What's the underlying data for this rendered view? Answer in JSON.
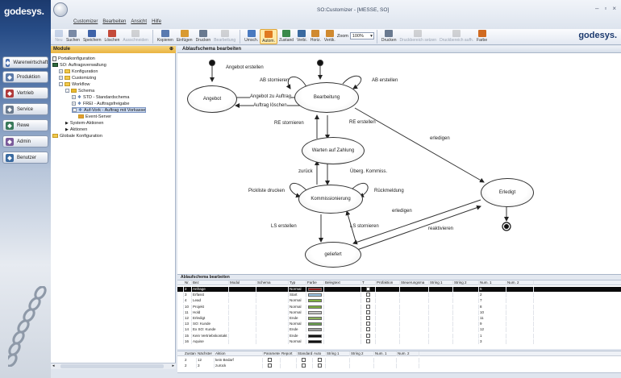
{
  "brand": "godesys.",
  "window": {
    "title": "SO:Customizer - [MESSE, SO]"
  },
  "menu": [
    "Customizer",
    "Bearbeiten",
    "Ansicht",
    "Hilfe"
  ],
  "nav": [
    {
      "label": "Warenwirtschaft",
      "color": "#4a6fb0"
    },
    {
      "label": "Produktion",
      "color": "#5c7aa8"
    },
    {
      "label": "Vertrieb",
      "color": "#b03a3a"
    },
    {
      "label": "Service",
      "color": "#6a7a8e"
    },
    {
      "label": "Rewe",
      "color": "#3a7a5a"
    },
    {
      "label": "Admin",
      "color": "#7a5a9a"
    },
    {
      "label": "Benutzer",
      "color": "#3a6aa0"
    }
  ],
  "ribbon": {
    "buttons": [
      {
        "label": "Neu",
        "state": "disabled",
        "color": "#6f8fc4"
      },
      {
        "label": "Suchen",
        "state": "normal",
        "color": "#7a8aa5"
      },
      {
        "label": "Speichern",
        "state": "normal",
        "color": "#3f63a8"
      },
      {
        "label": "Löschen",
        "state": "normal",
        "color": "#c44a3a"
      },
      {
        "label": "Ausschneiden",
        "state": "disabled",
        "color": "#8a8a8a"
      },
      {
        "label": "Kopieren",
        "state": "normal",
        "color": "#5a7ab0"
      },
      {
        "label": "Einfügen",
        "state": "normal",
        "color": "#d99a30"
      },
      {
        "label": "Drucken",
        "state": "normal",
        "color": "#6a7a90"
      },
      {
        "label": "Bearbeitung",
        "state": "disabled",
        "color": "#8a8a8a"
      },
      {
        "label": "Umsch.",
        "state": "normal",
        "color": "#4a7ac0"
      },
      {
        "label": "Autom.",
        "state": "selected",
        "color": "#e07a20"
      },
      {
        "label": "Zustand",
        "state": "normal",
        "color": "#3a8a4a"
      },
      {
        "label": "Verbi.",
        "state": "normal",
        "color": "#3a6aa0"
      },
      {
        "label": "Horiz.",
        "state": "normal",
        "color": "#d08a30"
      },
      {
        "label": "Vertik.",
        "state": "normal",
        "color": "#d08a30"
      }
    ],
    "zoom_label": "Zoom",
    "zoom_value": "100%",
    "right_buttons": [
      {
        "label": "Drucken",
        "state": "normal",
        "color": "#6a7a90"
      },
      {
        "label": "Druckbereich setzen",
        "state": "disabled",
        "color": "#8a8a8a"
      },
      {
        "label": "Druckbereich aufh.",
        "state": "disabled",
        "color": "#8a8a8a"
      },
      {
        "label": "Farbe",
        "state": "normal",
        "color": "#d06a20"
      }
    ]
  },
  "modules": {
    "title": "Module",
    "tree": [
      {
        "label": "Portalkonfiguration",
        "level": 0,
        "expander": "",
        "kind": "doc"
      },
      {
        "label": "SO: Auftragsverwaltung",
        "level": 0,
        "expander": "",
        "kind": "app"
      },
      {
        "label": "Konfiguration",
        "level": 1,
        "expander": "+",
        "kind": "folder"
      },
      {
        "label": "Customizing",
        "level": 1,
        "expander": "+",
        "kind": "folder"
      },
      {
        "label": "Workflow",
        "level": 1,
        "expander": "-",
        "kind": "folder"
      },
      {
        "label": "Schema",
        "level": 2,
        "expander": "-",
        "kind": "schema"
      },
      {
        "label": "STD - Standardschema",
        "level": 3,
        "expander": "+",
        "kind": "item"
      },
      {
        "label": "FREI - Auftragsfreigabe",
        "level": 3,
        "expander": "+",
        "kind": "item"
      },
      {
        "label": "Auf-Vork - Auftrag mit Vorkasse",
        "level": 3,
        "expander": "-",
        "kind": "item",
        "selected": true
      },
      {
        "label": "Event-Server",
        "level": 4,
        "expander": "",
        "kind": "event"
      },
      {
        "label": "System-Aktionen",
        "level": 2,
        "expander": "",
        "kind": "arrow"
      },
      {
        "label": "Aktionen",
        "level": 2,
        "expander": "",
        "kind": "arrow"
      },
      {
        "label": "Globale Konfiguration",
        "level": 0,
        "expander": "",
        "kind": "folder"
      }
    ]
  },
  "diagram": {
    "title": "Ablaufschema bearbeiten",
    "nodes": {
      "angebot": "Angebot",
      "bearbeitung": "Bearbeitung",
      "warten": "Warten auf Zahlung",
      "kommissionierung": "Kommissionierung",
      "geliefert": "geliefert",
      "erledigt": "Erledigt"
    },
    "edges": {
      "angebot_erstellen": "Angebot erstellen",
      "ab_stornieren": "AB stornieren",
      "ab_erstellen": "AB erstellen",
      "angebot_zu_auftrag": "Angebot zu Auftrag",
      "auftrag_loeschen": "Auftrag löschen",
      "re_stornieren": "RE stornieren",
      "re_erstellen": "RE erstellen",
      "erledigen1": "erledigen",
      "zurueck": "zurück",
      "uebergang_kommiss": "Überg. Kommiss.",
      "pickliste_drucken": "Pickliste drucken",
      "rueckmeldung": "Rückmeldung",
      "ls_erstellen": "LS erstellen",
      "ls_stornieren": "LS stornieren",
      "erledigen2": "erledigen",
      "reaktivieren": "reaktivieren"
    }
  },
  "grid": {
    "title": "Ablaufschema bearbeiten",
    "columns": [
      "Nr.",
      "Bez",
      "Modul",
      "Schema",
      "Typ",
      "Farbe",
      "Belegtext",
      "T",
      "Prüfaktion",
      "Steuerungsma",
      "String 1",
      "String 2",
      "Num. 1",
      "Num. 2"
    ],
    "rows": [
      {
        "nr": "2",
        "bez": "Anfrage",
        "typ": "Normal",
        "farbe": "#8a1a1a",
        "num1": "5",
        "selected": true
      },
      {
        "nr": "3",
        "bez": "Erfasst",
        "typ": "Start",
        "farbe": "#9fc8e8",
        "num1": "2"
      },
      {
        "nr": "4",
        "bez": "Lead",
        "typ": "Normal",
        "farbe": "#7fb040",
        "num1": "7"
      },
      {
        "nr": "10",
        "bez": "Projekt",
        "typ": "Normal",
        "farbe": "#7fb040",
        "num1": "8"
      },
      {
        "nr": "11",
        "bez": "Hold",
        "typ": "Normal",
        "farbe": "#c8c8c8",
        "num1": "10"
      },
      {
        "nr": "12",
        "bez": "Erledigt",
        "typ": "Ende",
        "farbe": "#8ab05a",
        "num1": "11"
      },
      {
        "nr": "13",
        "bez": "SO: Kunde",
        "typ": "Normal",
        "farbe": "#6aa050",
        "num1": "9"
      },
      {
        "nr": "14",
        "bez": "Ex SO: Kunde",
        "typ": "Ende",
        "farbe": "#a0a0a0",
        "num1": "12"
      },
      {
        "nr": "15",
        "bez": "Kein Vertriebskontakt",
        "typ": "Ende",
        "farbe": "#101010",
        "num1": "1"
      },
      {
        "nr": "16",
        "bez": "Aquise",
        "typ": "Normal",
        "farbe": "#101010",
        "num1": "3"
      }
    ]
  },
  "grid2": {
    "columns": [
      "Zustand",
      "Nächster",
      "Aktion",
      "Parameter",
      "Report",
      "Standard",
      "Auto",
      "String 1",
      "String 2",
      "Num. 1",
      "Num. 2"
    ],
    "rows": [
      {
        "zustand": "2",
        "naechster": "12",
        "aktion": "kein Bedarf"
      },
      {
        "zustand": "2",
        "naechster": "3",
        "aktion": "zurück"
      }
    ]
  }
}
